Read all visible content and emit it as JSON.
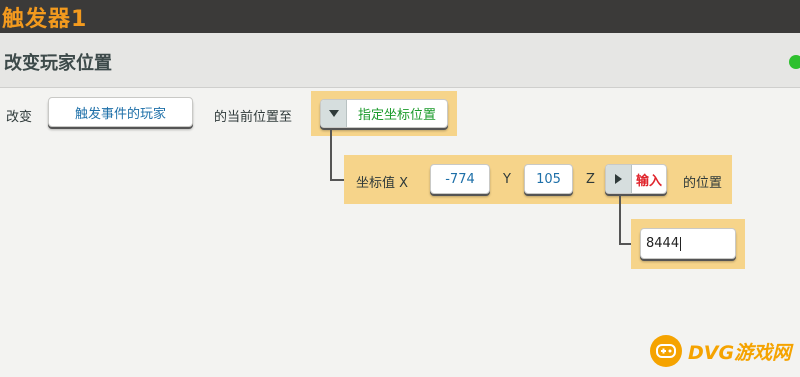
{
  "window": {
    "title": "触发器1"
  },
  "header": {
    "action_title": "改变玩家位置"
  },
  "colors": {
    "accent": "#f39a1e",
    "status": "#2ec02e",
    "highlight": "#f6d48a"
  },
  "statement": {
    "prefix": "改变",
    "target_player": "触发事件的玩家",
    "middle": "的当前位置至",
    "position_mode": "指定坐标位置"
  },
  "coords": {
    "label": "坐标值 X",
    "x_value": "-774",
    "y_label": "Y",
    "y_value": "105",
    "z_label": "Z",
    "z_mode": "输入",
    "suffix": "的位置",
    "z_input_value": "8444"
  },
  "icons": {
    "mode_dropdown": "caret-down-icon",
    "z_mode_toggle": "caret-right-icon",
    "status": "status-dot-icon",
    "watermark": "gamepad-icon"
  },
  "watermark": {
    "text": "DVG游戏网"
  }
}
